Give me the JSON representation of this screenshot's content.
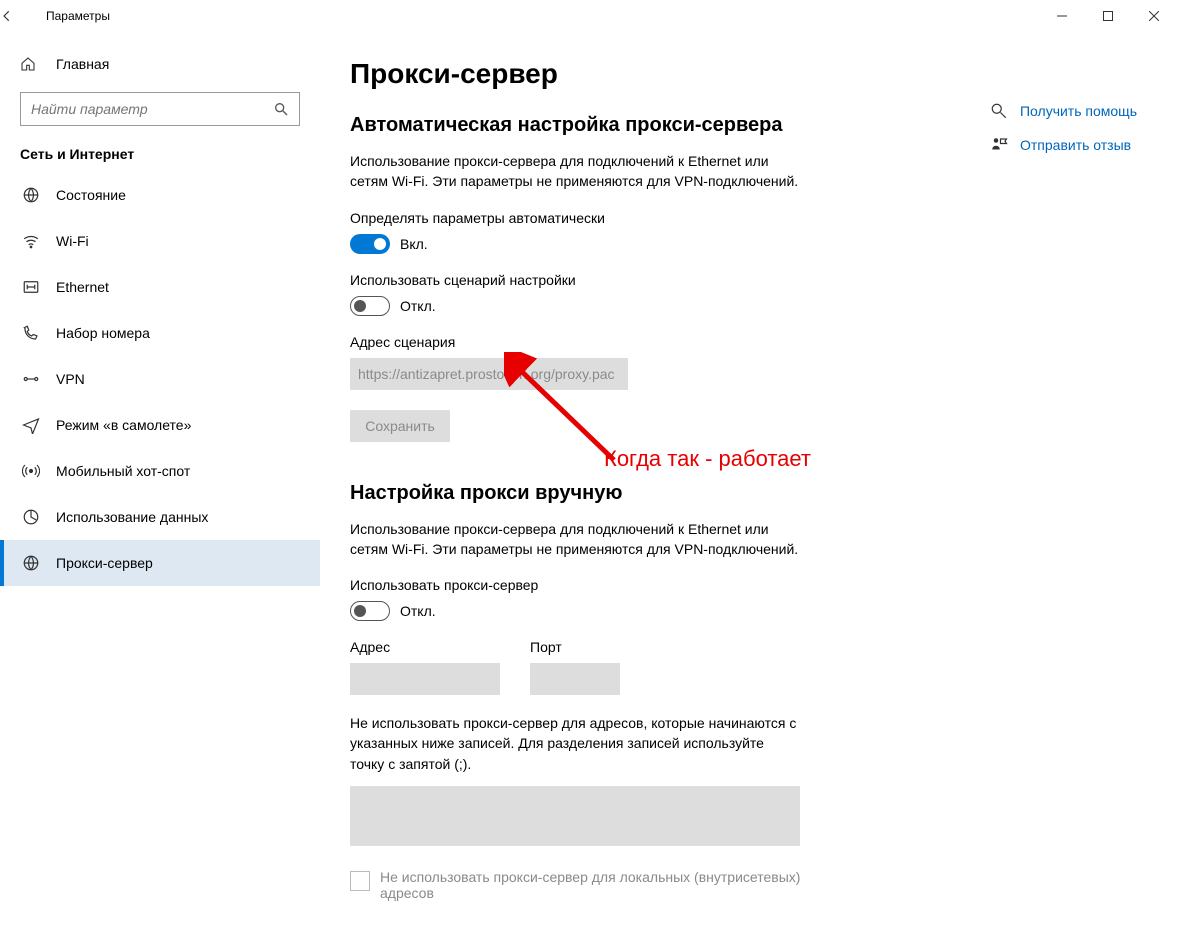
{
  "window": {
    "title": "Параметры"
  },
  "sidebar": {
    "home_label": "Главная",
    "search_placeholder": "Найти параметр",
    "category_label": "Сеть и Интернет",
    "items": [
      {
        "label": "Состояние"
      },
      {
        "label": "Wi-Fi"
      },
      {
        "label": "Ethernet"
      },
      {
        "label": "Набор номера"
      },
      {
        "label": "VPN"
      },
      {
        "label": "Режим «в самолете»"
      },
      {
        "label": "Мобильный хот-спот"
      },
      {
        "label": "Использование данных"
      },
      {
        "label": "Прокси-сервер"
      }
    ]
  },
  "main": {
    "page_title": "Прокси-сервер",
    "auto": {
      "heading": "Автоматическая настройка прокси-сервера",
      "description": "Использование прокси-сервера для подключений к Ethernet или сетям Wi-Fi. Эти параметры не применяются для VPN-подключений.",
      "detect_label": "Определять параметры автоматически",
      "detect_state": "Вкл.",
      "script_label": "Использовать сценарий настройки",
      "script_state": "Откл.",
      "address_label": "Адрес сценария",
      "address_value": "https://antizapret.prostovpn.org/proxy.pac",
      "save_label": "Сохранить"
    },
    "manual": {
      "heading": "Настройка прокси вручную",
      "description": "Использование прокси-сервера для подключений к Ethernet или сетям Wi-Fi. Эти параметры не применяются для VPN-подключений.",
      "use_label": "Использовать прокси-сервер",
      "use_state": "Откл.",
      "address_label": "Адрес",
      "port_label": "Порт",
      "exceptions_label": "Не использовать прокси-сервер для адресов, которые начинаются с указанных ниже записей. Для разделения записей используйте точку с запятой (;).",
      "local_checkbox_label": "Не использовать прокси-сервер для локальных (внутрисетевых) адресов"
    }
  },
  "help": {
    "get_help": "Получить помощь",
    "feedback": "Отправить отзыв"
  },
  "annotation": {
    "text": "Когда так - работает"
  }
}
